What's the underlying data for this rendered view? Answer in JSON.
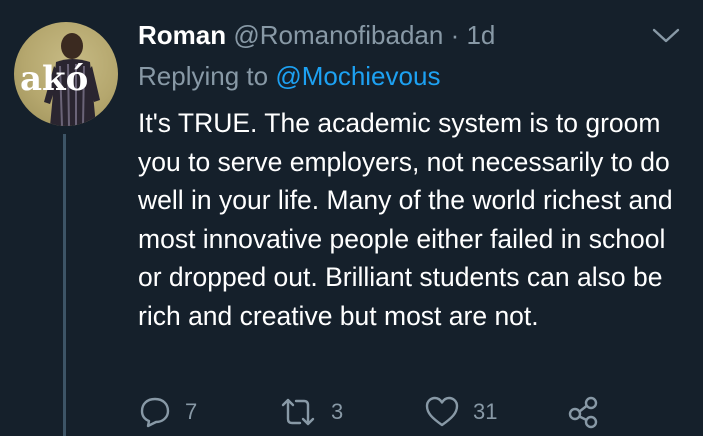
{
  "tweet": {
    "display_name": "Roman",
    "handle": "@Romanofibadan",
    "separator": "·",
    "time": "1d",
    "replying_prefix": "Replying to",
    "replying_to": "@Mochievous",
    "text": "It's TRUE. The academic system is to groom you to serve employers, not necessarily to do well in your life. Many of the world richest and most innovative people either failed in school or dropped out. Brilliant students can also be rich and creative but most are not.",
    "avatar_text": "akó"
  },
  "actions": {
    "reply_count": "7",
    "retweet_count": "3",
    "like_count": "31"
  },
  "icons": {
    "menu": "chevron-down-icon",
    "reply": "reply-icon",
    "retweet": "retweet-icon",
    "like": "heart-icon",
    "share": "share-icon"
  },
  "colors": {
    "background": "#15202b",
    "text_primary": "#ffffff",
    "text_secondary": "#8899a6",
    "link": "#1da1f2",
    "thread_line": "#3d5466"
  }
}
